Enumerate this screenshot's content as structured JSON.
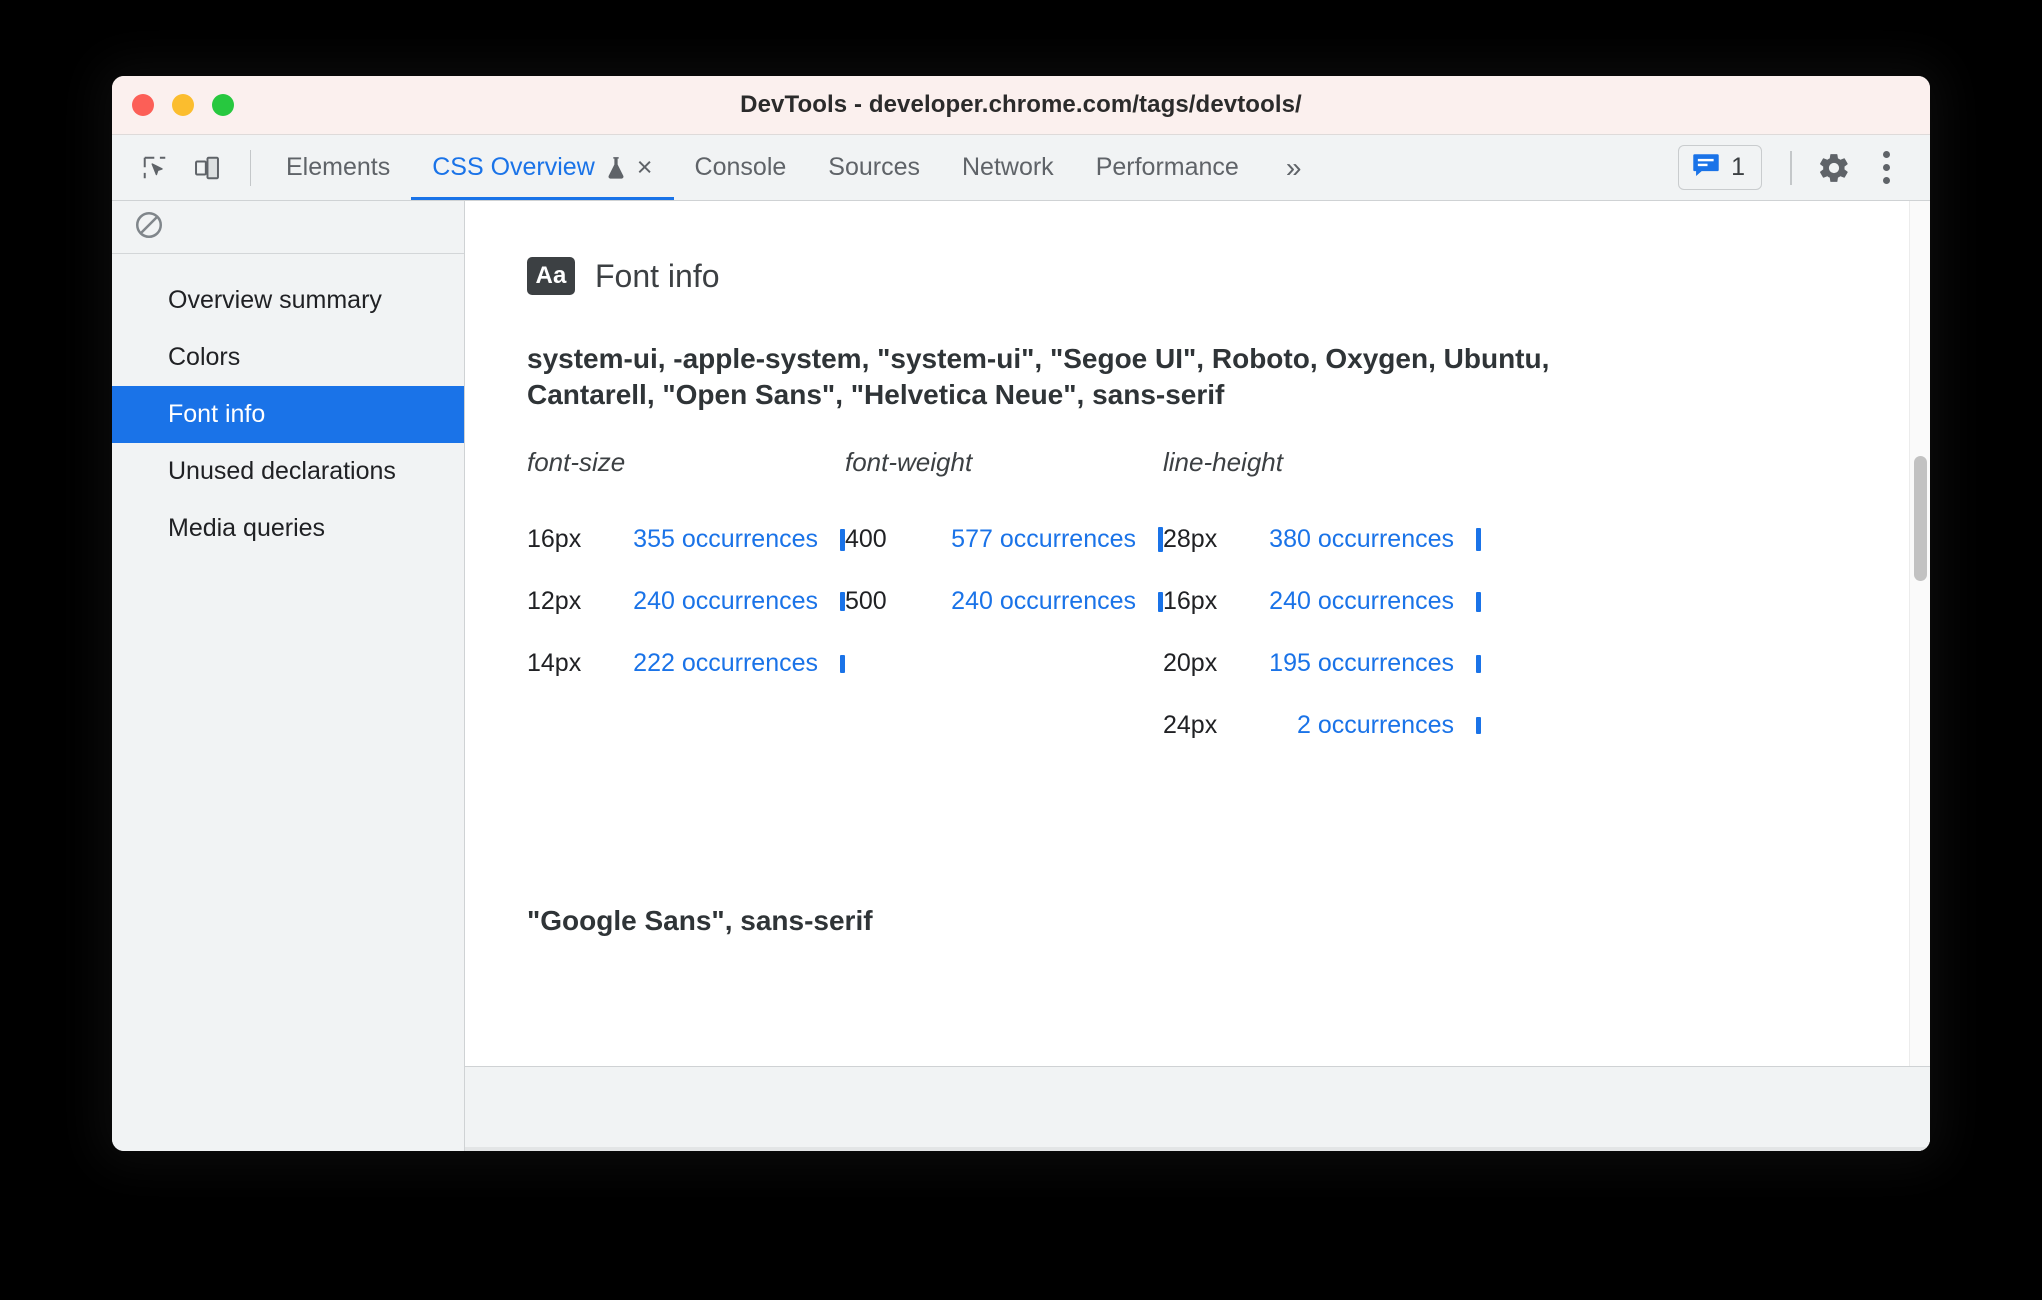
{
  "window": {
    "title": "DevTools - developer.chrome.com/tags/devtools/",
    "traffic_lights": [
      "close",
      "minimize",
      "zoom"
    ]
  },
  "toolbar": {
    "inspect_icon": "inspect-cursor-icon",
    "device_toggle_icon": "device-toolbar-icon",
    "overflow_label": "»",
    "message_count": "1",
    "message_icon": "message-bubble-icon",
    "settings_icon": "gear-icon",
    "more_options_icon": "kebab-menu-icon"
  },
  "tabs": [
    {
      "label": "Elements",
      "active": false,
      "closable": false,
      "experimental": false
    },
    {
      "label": "CSS Overview",
      "active": true,
      "closable": true,
      "experimental": true,
      "close_label": "×"
    },
    {
      "label": "Console",
      "active": false,
      "closable": false,
      "experimental": false
    },
    {
      "label": "Sources",
      "active": false,
      "closable": false,
      "experimental": false
    },
    {
      "label": "Network",
      "active": false,
      "closable": false,
      "experimental": false
    },
    {
      "label": "Performance",
      "active": false,
      "closable": false,
      "experimental": false
    }
  ],
  "sidebar": {
    "toolbar": {
      "clear_icon": "no-entry-clear-icon"
    },
    "items": [
      {
        "label": "Overview summary",
        "selected": false
      },
      {
        "label": "Colors",
        "selected": false
      },
      {
        "label": "Font info",
        "selected": true
      },
      {
        "label": "Unused declarations",
        "selected": false
      },
      {
        "label": "Media queries",
        "selected": false
      }
    ]
  },
  "content": {
    "section_badge": "Aa",
    "section_title": "Font info",
    "font_families": [
      "system-ui, -apple-system, \"system-ui\", \"Segoe UI\", Roboto, Oxygen, Ubuntu, Cantarell, \"Open Sans\", \"Helvetica Neue\", sans-serif",
      "\"Google Sans\", sans-serif"
    ],
    "columns": [
      {
        "header": "font-size",
        "rows": [
          {
            "value": "16px",
            "occurrences": "355 occurrences",
            "count": 355
          },
          {
            "value": "12px",
            "occurrences": "240 occurrences",
            "count": 240
          },
          {
            "value": "14px",
            "occurrences": "222 occurrences",
            "count": 222
          }
        ]
      },
      {
        "header": "font-weight",
        "rows": [
          {
            "value": "400",
            "occurrences": "577 occurrences",
            "count": 577
          },
          {
            "value": "500",
            "occurrences": "240 occurrences",
            "count": 240
          }
        ]
      },
      {
        "header": "line-height",
        "rows": [
          {
            "value": "28px",
            "occurrences": "380 occurrences",
            "count": 380
          },
          {
            "value": "16px",
            "occurrences": "240 occurrences",
            "count": 240
          },
          {
            "value": "20px",
            "occurrences": "195 occurrences",
            "count": 195
          },
          {
            "value": "24px",
            "occurrences": "2 occurrences",
            "count": 2
          }
        ]
      }
    ]
  },
  "colors": {
    "accent": "#1a73e8",
    "titlebar": "#fbf0ee",
    "toolbar": "#f1f3f4",
    "text": "#202124"
  }
}
